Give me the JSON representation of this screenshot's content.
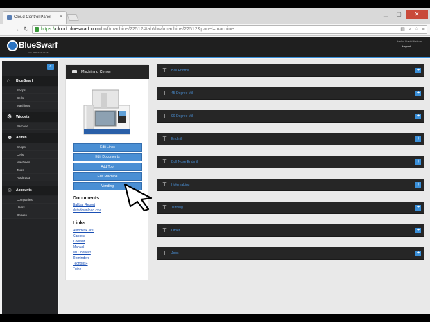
{
  "browser": {
    "tab_title": "Cloud Control Panel",
    "url_scheme": "https://",
    "url_host": "cloud.blueswarf.com",
    "url_path": "/bwf/machine/22512#tab!/bwf/machine/22512&panel=machine"
  },
  "header": {
    "logo": "BlueSwarf",
    "tagline": "THE PERFECT CAST",
    "hello": "Hello, David Nelson",
    "logout": "Logout"
  },
  "sidebar": [
    {
      "section": "BlueSwarf",
      "icon": "home-icon",
      "items": [
        "Shops",
        "Cells",
        "Machines"
      ]
    },
    {
      "section": "Widgets",
      "icon": "gear-icon",
      "items": [
        "Barcode"
      ]
    },
    {
      "section": "Admin",
      "icon": "person-icon",
      "items": [
        "Shops",
        "Cells",
        "Machines",
        "Tools",
        "Audit Log"
      ]
    },
    {
      "section": "Accounts",
      "icon": "people-icon",
      "items": [
        "Companies",
        "Users",
        "Groups"
      ]
    }
  ],
  "panel": {
    "title": "Machining Center",
    "buttons": [
      "Edit Links",
      "Edit Documents",
      "Add Tool",
      "Edit Machine",
      "Vending"
    ],
    "documents_title": "Documents",
    "documents": [
      "Ballbar Report",
      "datadownload.csv"
    ],
    "links_title": "Links",
    "links": [
      "Autodesk 360",
      "Camera",
      "Coolant",
      "Manual",
      "MTConnect",
      "Reminders",
      "Techops+",
      "Tuine"
    ]
  },
  "categories": [
    "Ball Endmill",
    "45 Degree Mill",
    "90 Degree Mill",
    "Endmill",
    "Bull Nose Endmill",
    "Holemaking",
    "Turning",
    "Other",
    "Jobs"
  ],
  "colors": {
    "accent": "#3a8fd8",
    "header": "#1f1f1f",
    "sidebar": "#232426"
  }
}
